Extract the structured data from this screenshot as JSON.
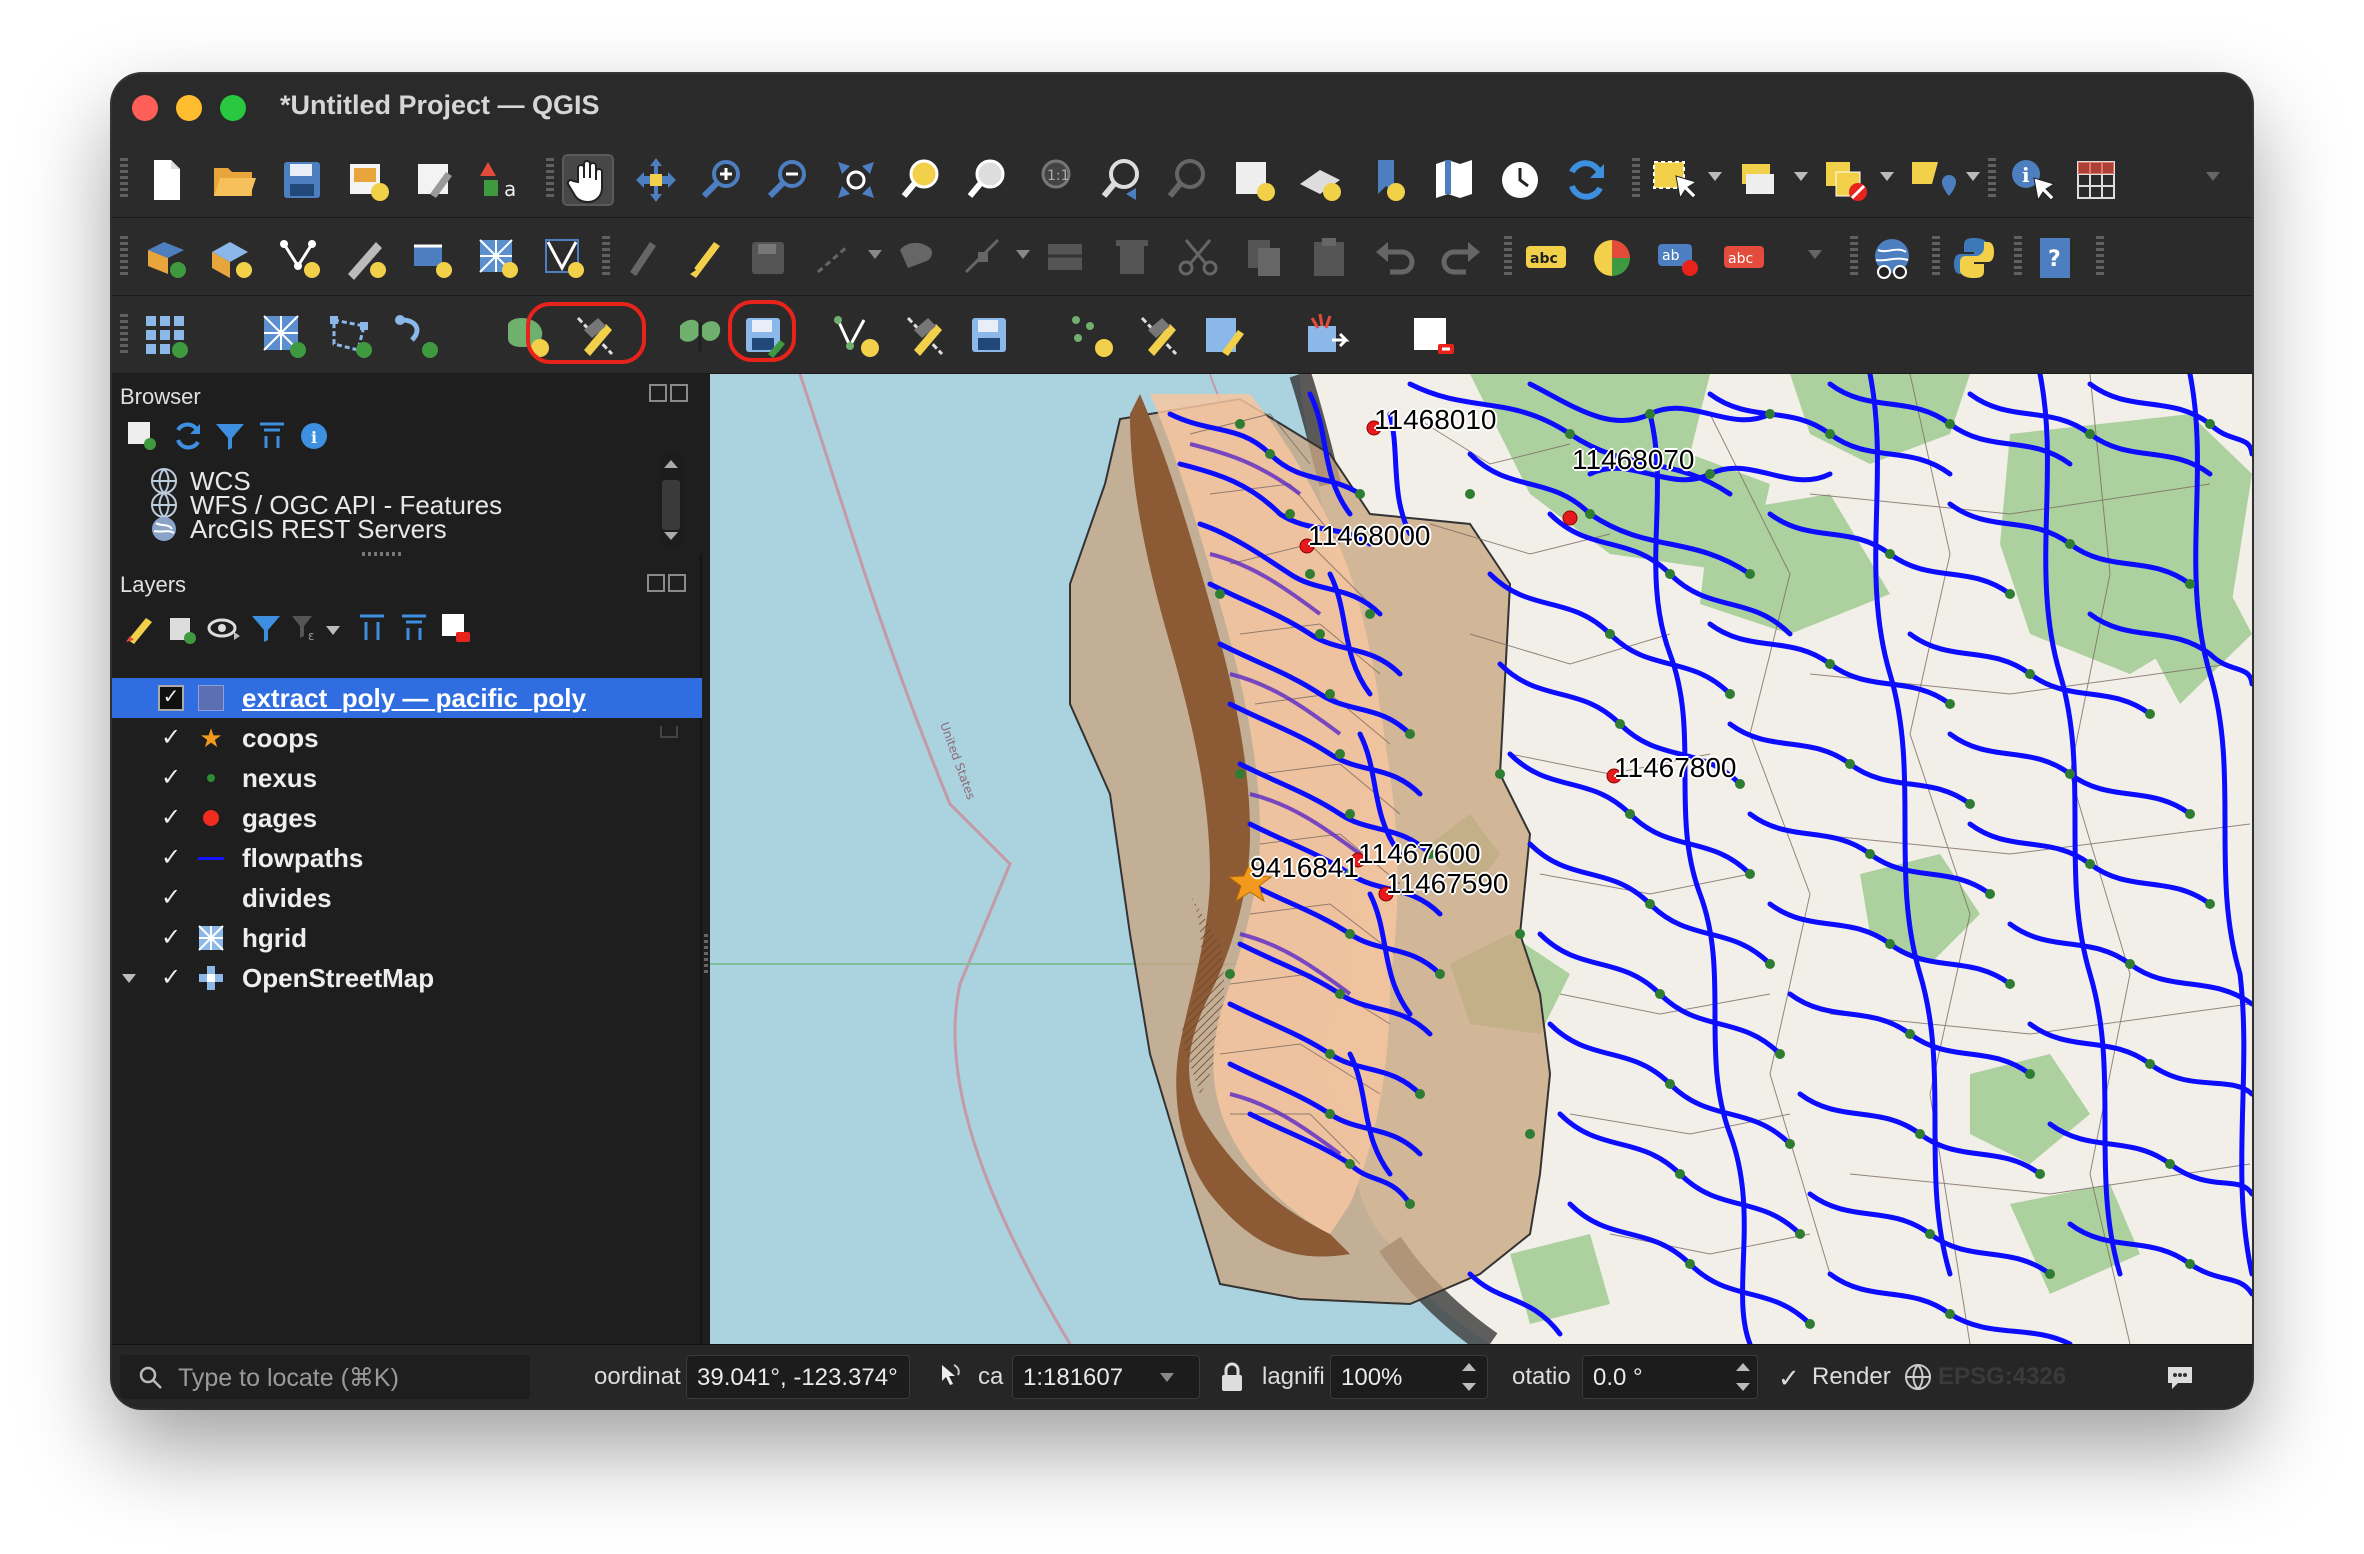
{
  "window": {
    "title": "*Untitled Project — QGIS"
  },
  "browser": {
    "title": "Browser",
    "items": [
      {
        "label": "WCS",
        "icon": "globe-icon"
      },
      {
        "label": "WFS / OGC API - Features",
        "icon": "globe-icon"
      },
      {
        "label": "ArcGIS REST Servers",
        "icon": "arcgis-globe-icon"
      }
    ]
  },
  "layers": {
    "title": "Layers",
    "items": [
      {
        "name": "extract_poly — pacific_poly",
        "checked": true,
        "selected": true,
        "symbol": "polygon-swatch"
      },
      {
        "name": "coops",
        "checked": true,
        "symbol": "orange-star"
      },
      {
        "name": "nexus",
        "checked": true,
        "symbol": "green-dot"
      },
      {
        "name": "gages",
        "checked": true,
        "symbol": "red-dot"
      },
      {
        "name": "flowpaths",
        "checked": true,
        "symbol": "blue-line"
      },
      {
        "name": "divides",
        "checked": true,
        "symbol": "none"
      },
      {
        "name": "hgrid",
        "checked": true,
        "symbol": "mesh-icon"
      },
      {
        "name": "OpenStreetMap",
        "checked": true,
        "symbol": "xyz-tiles-icon",
        "expandable": true
      }
    ]
  },
  "map": {
    "gage_labels": [
      "11468010",
      "11468070",
      "11468000",
      "11467800",
      "11467600",
      "11467590",
      "9416841"
    ],
    "colors": {
      "ocean": "#aad3df",
      "land": "#f2efe9",
      "forest": "#add19e",
      "flowpaths": "#0c0cff",
      "nexus": "#2e7d32",
      "gages": "#e41a1c",
      "pacific_poly": "#c9a582",
      "hgrid": "#8c5a35",
      "divides": "#f6c5a0"
    }
  },
  "statusbar": {
    "locate_placeholder": "Type to locate (⌘K)",
    "coordinate_label": "oordinat",
    "coordinate_value": "39.041°, -123.374°",
    "scale_label": "ca",
    "scale_value": "1:181607",
    "magnifier_label": "lagnifi",
    "magnifier_value": "100%",
    "rotation_label": "otatio",
    "rotation_value": "0.0 °",
    "render_label": "Render",
    "crs_value": "EPSG:4326"
  }
}
